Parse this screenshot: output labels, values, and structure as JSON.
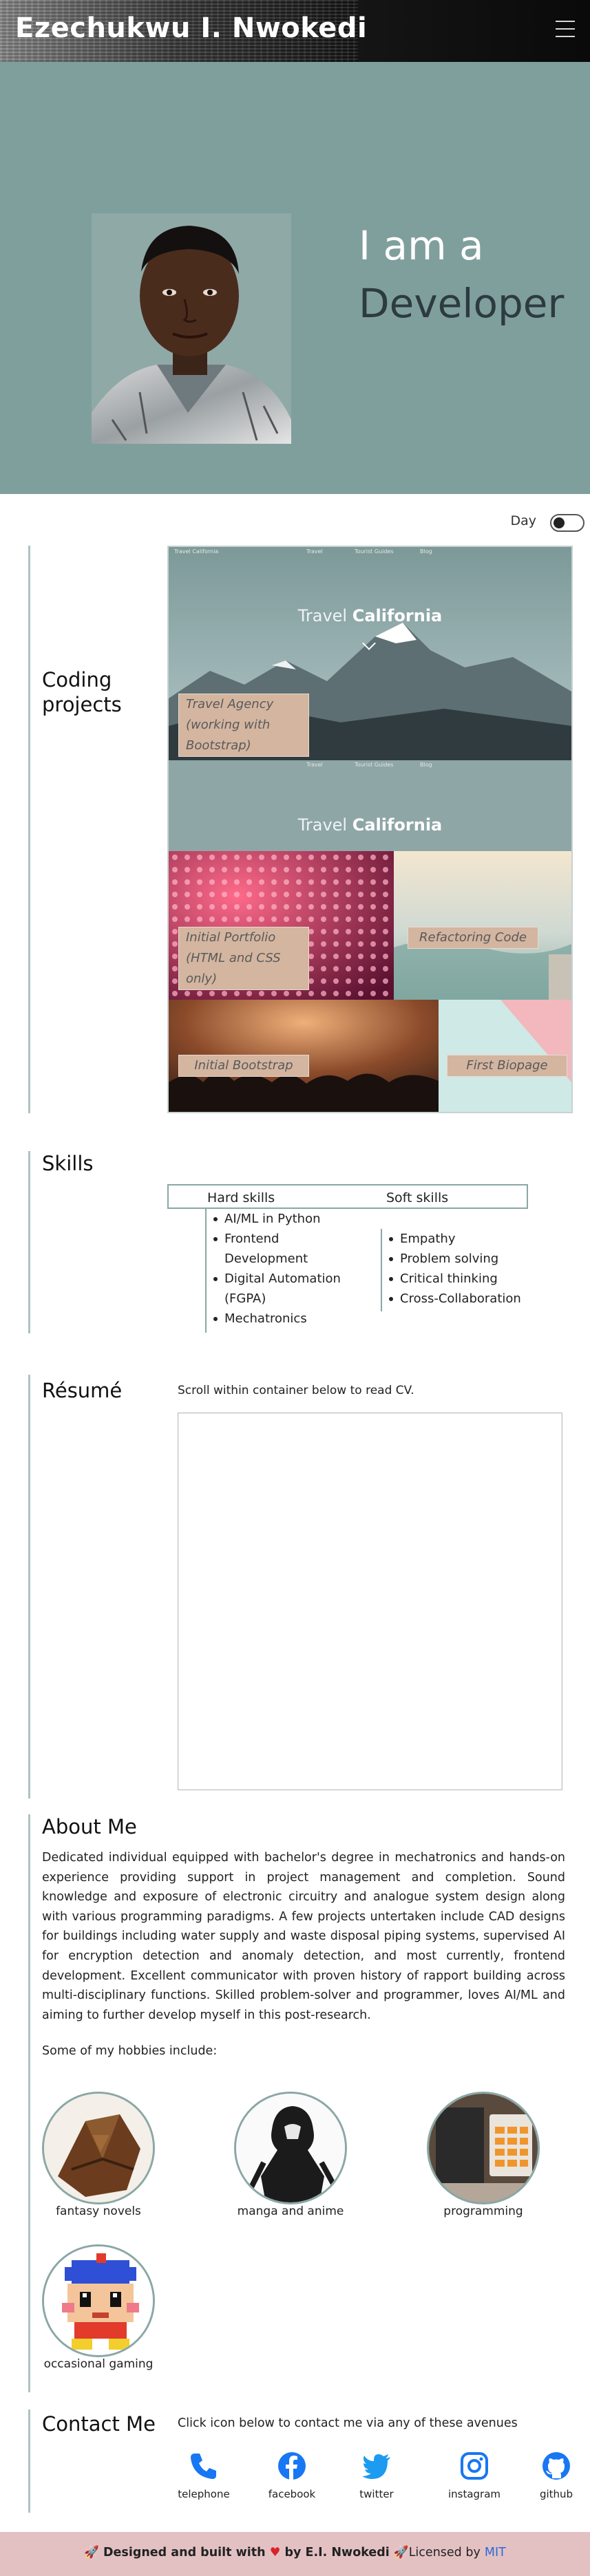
{
  "header": {
    "brand": "Ezechukwu I. Nwokedi",
    "menu_icon": "hamburger-icon"
  },
  "hero": {
    "line1": "I am a",
    "line2": "Developer"
  },
  "theme": {
    "label": "Day"
  },
  "sections": {
    "projects": "Coding projects",
    "skills": "Skills",
    "resume": "Résumé",
    "about": "About Me",
    "contact": "Contact Me"
  },
  "projects": {
    "travel_title_light": "Travel",
    "travel_title_bold": "California",
    "mini_nav": [
      "Travel California",
      "Travel",
      "Tourist Guides",
      "Blog"
    ],
    "items": [
      "Travel Agency (working with Bootstrap)",
      "Initial Portfolio (HTML and CSS only)",
      "Refactoring Code",
      "Initial Bootstrap",
      "First Biopage"
    ]
  },
  "skills": {
    "hard_title": "Hard skills",
    "soft_title": "Soft skills",
    "hard": [
      "AI/ML in Python",
      "Frontend Development",
      "Digital Automation (FGPA)",
      "Mechatronics"
    ],
    "soft": [
      "Empathy",
      "Problem solving",
      "Critical thinking",
      "Cross-Collaboration"
    ]
  },
  "resume": {
    "note": "Scroll within container below to read CV."
  },
  "about": {
    "paragraph": "Dedicated individual equipped with bachelor's degree in mechatronics and hands-on experience providing support in project management and completion. Sound knowledge and exposure of electronic circuitry and analogue system design along with various programming paradigms. A few projects untertaken include CAD designs for buildings including water supply and waste disposal piping systems, supervised AI for encryption detection and anomaly detection, and most currently, frontend development. Excellent communicator with proven history of rapport building across multi-disciplinary functions. Skilled problem-solver and programmer, loves AI/ML and aiming to further develop myself in this post-research.",
    "hobbies_intro": "Some of my hobbies include:",
    "hobbies": [
      "fantasy novels",
      "manga and anime",
      "programming",
      "occasional gaming"
    ]
  },
  "contact": {
    "note": "Click icon below to contact me via any of these avenues",
    "items": [
      {
        "label": "telephone",
        "icon": "phone-icon"
      },
      {
        "label": "facebook",
        "icon": "facebook-icon"
      },
      {
        "label": "twitter",
        "icon": "twitter-icon"
      },
      {
        "label": "instagram",
        "icon": "instagram-icon"
      },
      {
        "label": "github",
        "icon": "github-icon"
      }
    ]
  },
  "footer": {
    "designed": "Designed and built with",
    "by": "by E.I. Nwokedi",
    "licensed": "Licensed by",
    "license": "MIT"
  },
  "colors": {
    "accent": "#7f9f9d",
    "border": "#8aa7a5",
    "footer": "#e3c1c3",
    "link": "#2a6ad6"
  }
}
